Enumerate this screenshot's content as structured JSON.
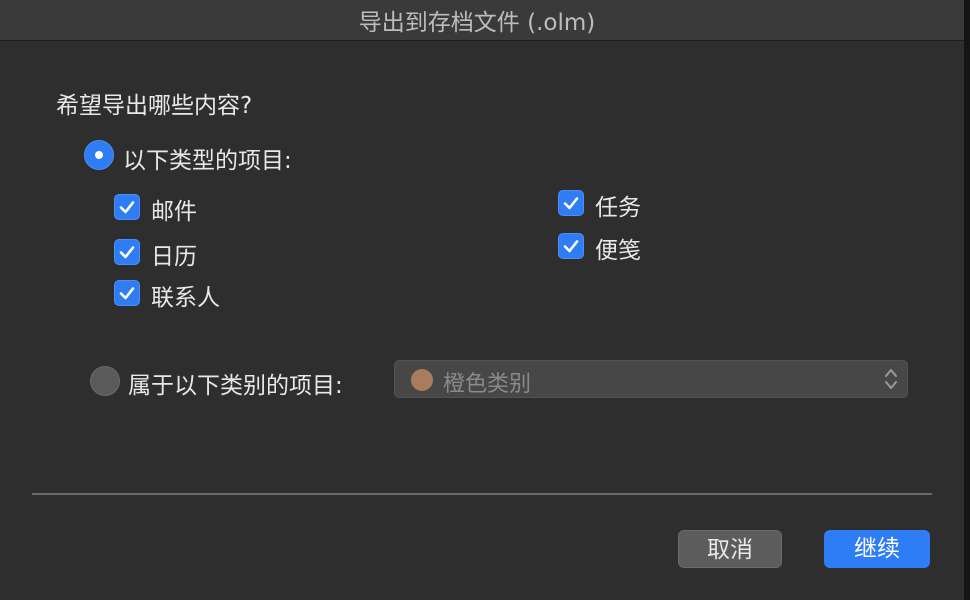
{
  "window": {
    "title": "导出到存档文件 (.olm)"
  },
  "question": "希望导出哪些内容?",
  "options": {
    "by_type": {
      "label": "以下类型的项目:",
      "selected": true,
      "items": [
        {
          "label": "邮件",
          "checked": true
        },
        {
          "label": "日历",
          "checked": true
        },
        {
          "label": "联系人",
          "checked": true
        },
        {
          "label": "任务",
          "checked": true
        },
        {
          "label": "便笺",
          "checked": true
        }
      ]
    },
    "by_category": {
      "label": "属于以下类别的项目:",
      "selected": false,
      "popup_value": "橙色类别",
      "swatch_color": "#a97c5e"
    }
  },
  "buttons": {
    "cancel": "取消",
    "continue": "继续"
  },
  "colors": {
    "accent": "#2f7df5",
    "background": "#2e2e2e"
  }
}
